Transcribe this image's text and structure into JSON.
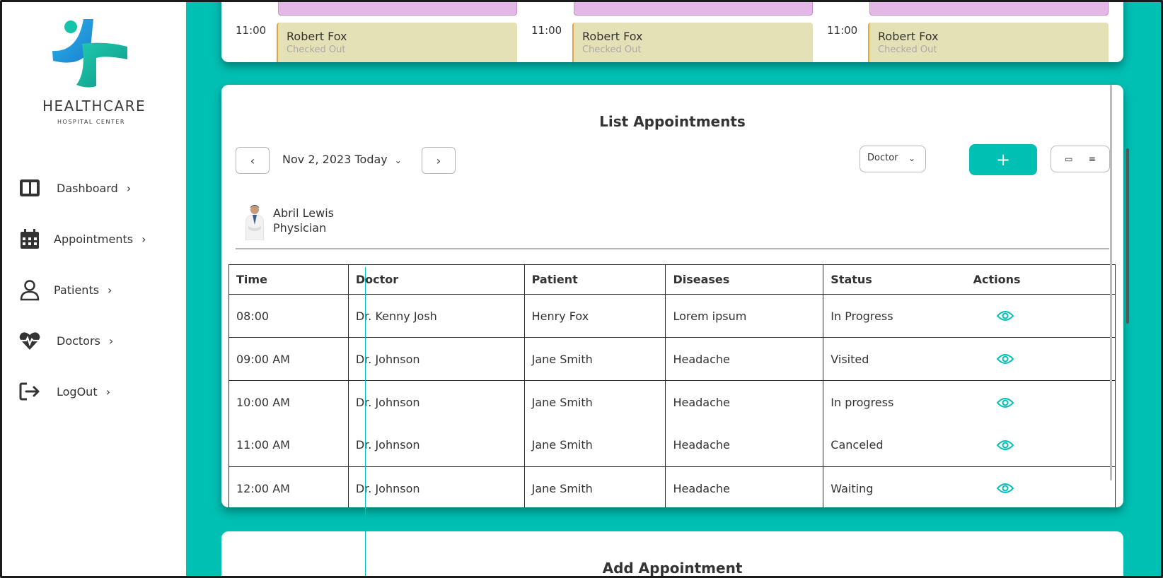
{
  "brand": {
    "title": "HEALTHCARE",
    "subtitle": "HOSPITAL CENTER",
    "accent": "#00bfb3"
  },
  "sidebar": {
    "items": [
      {
        "label": "Dashboard",
        "icon": "dashboard-icon"
      },
      {
        "label": "Appointments",
        "icon": "calendar-icon"
      },
      {
        "label": "Patients",
        "icon": "user-icon"
      },
      {
        "label": "Doctors",
        "icon": "heartbeat-icon"
      },
      {
        "label": "LogOut",
        "icon": "logout-icon"
      }
    ]
  },
  "schedule": {
    "columns": [
      {
        "time": "11:00",
        "name": "Robert Fox",
        "status": "Checked Out"
      },
      {
        "time": "11:00",
        "name": "Robert Fox",
        "status": "Checked Out"
      },
      {
        "time": "11:00",
        "name": "Robert Fox",
        "status": "Checked Out"
      }
    ]
  },
  "list": {
    "title": "List Appointments",
    "date_label": "Nov 2, 2023 Today",
    "doctor_select": "Doctor",
    "add_label": "+",
    "doctor": {
      "name": "Abril Lewis",
      "role": "Physician"
    },
    "columns": [
      "Time",
      "Doctor",
      "Patient",
      "Diseases",
      "Status",
      "Actions"
    ],
    "rows": [
      {
        "time": "08:00",
        "doctor": "Dr. Kenny Josh",
        "patient": "Henry Fox",
        "disease": "Lorem ipsum",
        "status": "In Progress"
      },
      {
        "time": "09:00 AM",
        "doctor": "Dr. Johnson",
        "patient": "Jane Smith",
        "disease": "Headache",
        "status": "Visited"
      },
      {
        "time": "10:00 AM",
        "doctor": "Dr. Johnson",
        "patient": "Jane Smith",
        "disease": "Headache",
        "status": "In progress"
      },
      {
        "time": "11:00 AM",
        "doctor": "Dr. Johnson",
        "patient": "Jane Smith",
        "disease": "Headache",
        "status": "Canceled"
      },
      {
        "time": "12:00 AM",
        "doctor": "Dr. Johnson",
        "patient": "Jane Smith",
        "disease": "Headache",
        "status": "Waiting"
      }
    ]
  },
  "add": {
    "title": "Add Appointment"
  }
}
